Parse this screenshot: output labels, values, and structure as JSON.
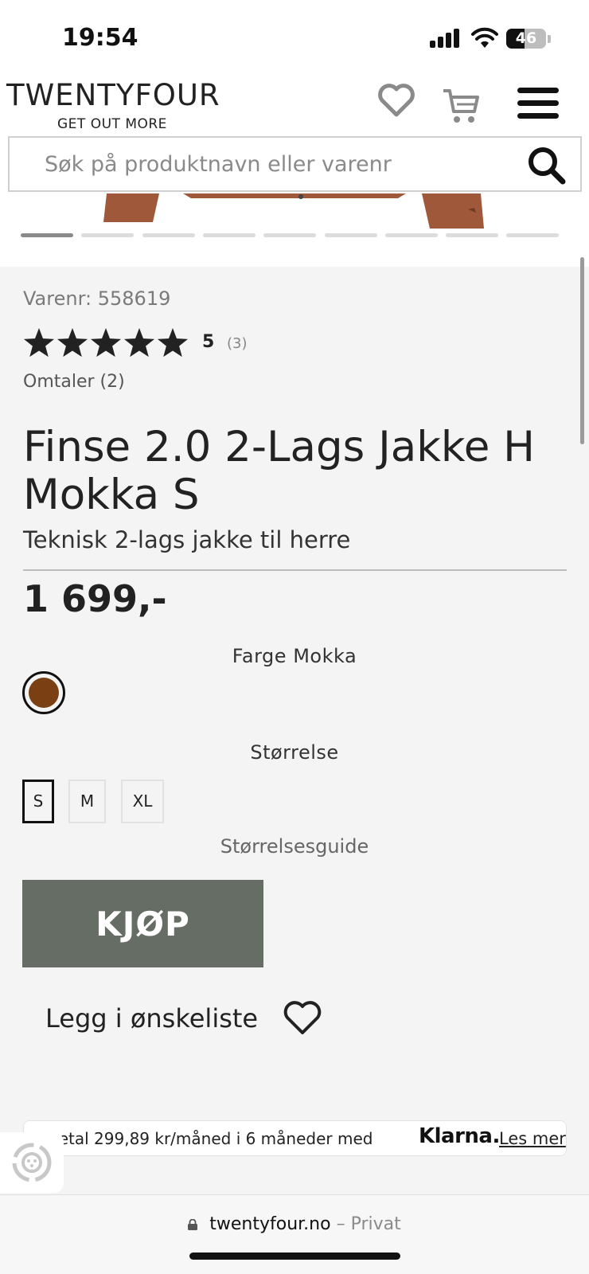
{
  "status_bar": {
    "time": "19:54",
    "battery_level": "46",
    "battery_percent": 46
  },
  "header": {
    "logo_text": "TWENTYFOUR",
    "logo_tagline": "GET OUT MORE",
    "icons": [
      "heart-icon",
      "cart-icon",
      "menu-icon"
    ]
  },
  "search": {
    "placeholder": "Søk på produktnavn eller varenr",
    "value": ""
  },
  "gallery": {
    "image_count": 9,
    "active_index": 0
  },
  "product": {
    "varenr_label": "Varenr:",
    "varenr": "558619",
    "rating_stars": 5,
    "rating_value": "5",
    "rating_count": "(3)",
    "reviews_link": "Omtaler (2)",
    "title": "Finse 2.0 2-Lags Jakke H Mokka S",
    "subtitle": "Teknisk 2-lags jakke til herre",
    "price": "1 699,-",
    "color_label": "Farge",
    "color_value": "Mokka",
    "color_swatch": "#7a3f12",
    "size_label": "Størrelse",
    "sizes": [
      "S",
      "M",
      "XL"
    ],
    "selected_size": "S",
    "size_guide": "Størrelsesguide",
    "buy_label": "KJØP",
    "wishlist_label": "Legg i ønskeliste"
  },
  "klarna": {
    "text": "Betal 299,89 kr/måned i 6 måneder med",
    "brand": "Klarna.",
    "link": "Les mer"
  },
  "browser": {
    "domain": "twentyfour.no",
    "separator": "–",
    "mode": "Privat"
  },
  "colors": {
    "buy_button": "#666d64",
    "panel_bg": "#f4f4f4",
    "swatch_mokka": "#7a3f12"
  }
}
